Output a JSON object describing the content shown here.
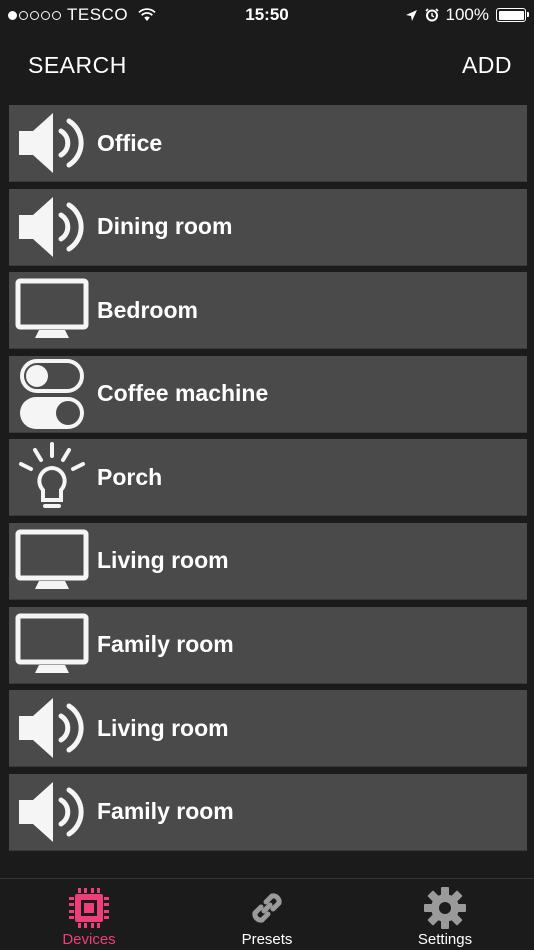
{
  "status_bar": {
    "carrier": "TESCO",
    "signal_filled": 1,
    "signal_total": 5,
    "time": "15:50",
    "battery": "100%"
  },
  "nav": {
    "left_label": "SEARCH",
    "right_label": "ADD"
  },
  "devices": [
    {
      "label": "Office",
      "icon": "speaker-icon"
    },
    {
      "label": "Dining room",
      "icon": "speaker-icon"
    },
    {
      "label": "Bedroom",
      "icon": "tv-icon"
    },
    {
      "label": "Coffee machine",
      "icon": "switch-icon"
    },
    {
      "label": "Porch",
      "icon": "lightbulb-icon"
    },
    {
      "label": "Living room",
      "icon": "tv-icon"
    },
    {
      "label": "Family room",
      "icon": "tv-icon"
    },
    {
      "label": "Living room",
      "icon": "speaker-icon"
    },
    {
      "label": "Family room",
      "icon": "speaker-icon"
    }
  ],
  "tabs": [
    {
      "label": "Devices",
      "icon": "chip-icon",
      "active": true
    },
    {
      "label": "Presets",
      "icon": "link-icon",
      "active": false
    },
    {
      "label": "Settings",
      "icon": "gear-icon",
      "active": false
    }
  ],
  "colors": {
    "background": "#1b1b1b",
    "row": "#4a4a4a",
    "accent": "#ee3f7a",
    "inactive_icon": "#9a9a9a"
  }
}
